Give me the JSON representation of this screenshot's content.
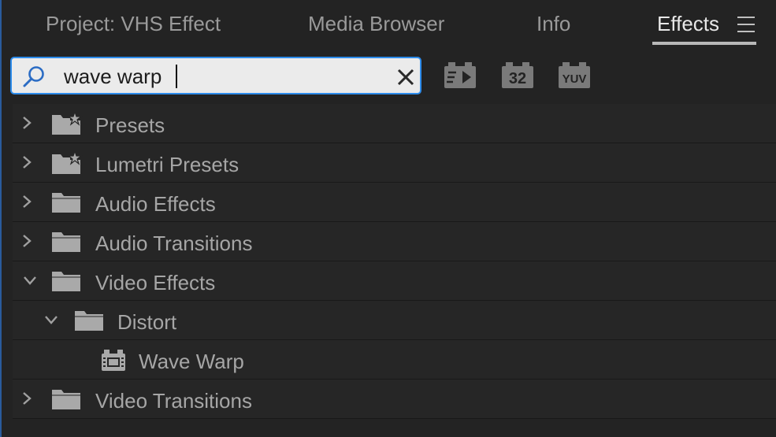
{
  "tabs": [
    {
      "label": "Project: VHS Effect",
      "active": false
    },
    {
      "label": "Media Browser",
      "active": false
    },
    {
      "label": "Info",
      "active": false
    },
    {
      "label": "Effects",
      "active": true
    }
  ],
  "panel_menu_icon": "hamburger-menu-icon",
  "search": {
    "value": "wave warp",
    "icon": "search-icon",
    "clear_icon": "close-icon"
  },
  "filters": [
    {
      "name": "accelerated-effects-filter",
      "label": ""
    },
    {
      "name": "32-bit-color-filter",
      "label": "32"
    },
    {
      "name": "yuv-filter",
      "label": "YUV"
    }
  ],
  "tree": [
    {
      "label": "Presets",
      "expanded": false,
      "icon": "preset-folder-icon",
      "level": 0
    },
    {
      "label": "Lumetri Presets",
      "expanded": false,
      "icon": "preset-folder-icon",
      "level": 0
    },
    {
      "label": "Audio Effects",
      "expanded": false,
      "icon": "folder-icon",
      "level": 0
    },
    {
      "label": "Audio Transitions",
      "expanded": false,
      "icon": "folder-icon",
      "level": 0
    },
    {
      "label": "Video Effects",
      "expanded": true,
      "icon": "folder-icon",
      "level": 0
    },
    {
      "label": "Distort",
      "expanded": true,
      "icon": "folder-icon",
      "level": 1
    },
    {
      "label": "Wave Warp",
      "expanded": null,
      "icon": "effect-icon",
      "level": 2
    },
    {
      "label": "Video Transitions",
      "expanded": false,
      "icon": "folder-icon",
      "level": 0
    }
  ],
  "colors": {
    "background": "#232323",
    "accent": "#2d8ceb",
    "text": "#a6a6a6"
  }
}
